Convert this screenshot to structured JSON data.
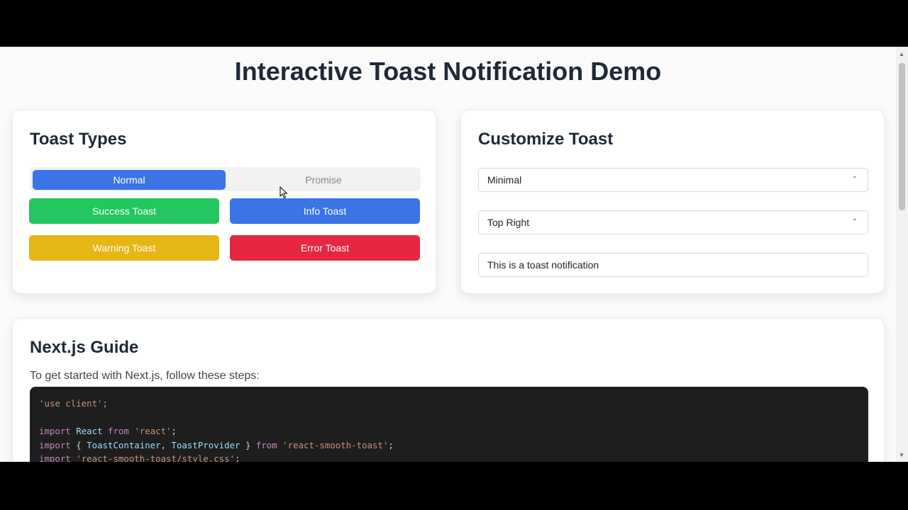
{
  "page": {
    "title": "Interactive Toast Notification Demo"
  },
  "toast_types": {
    "title": "Toast Types",
    "tabs": [
      {
        "label": "Normal",
        "active": true
      },
      {
        "label": "Promise",
        "active": false
      }
    ],
    "buttons": [
      {
        "label": "Success Toast",
        "color": "#22c55e"
      },
      {
        "label": "Info Toast",
        "color": "#3b74e6"
      },
      {
        "label": "Warning Toast",
        "color": "#e6b616"
      },
      {
        "label": "Error Toast",
        "color": "#e5283f"
      }
    ]
  },
  "customize": {
    "title": "Customize Toast",
    "style_select": "Minimal",
    "position_select": "Top Right",
    "message_input": "This is a toast notification"
  },
  "guide": {
    "title": "Next.js Guide",
    "description": "To get started with Next.js, follow these steps:",
    "code_lines": [
      "'use client';",
      "",
      "import React from 'react';",
      "import { ToastContainer, ToastProvider } from 'react-smooth-toast';",
      "import 'react-smooth-toast/style.css';"
    ]
  },
  "icons": {
    "select": "chevron-up-down-icon",
    "cursor": "mouse-pointer-icon"
  }
}
